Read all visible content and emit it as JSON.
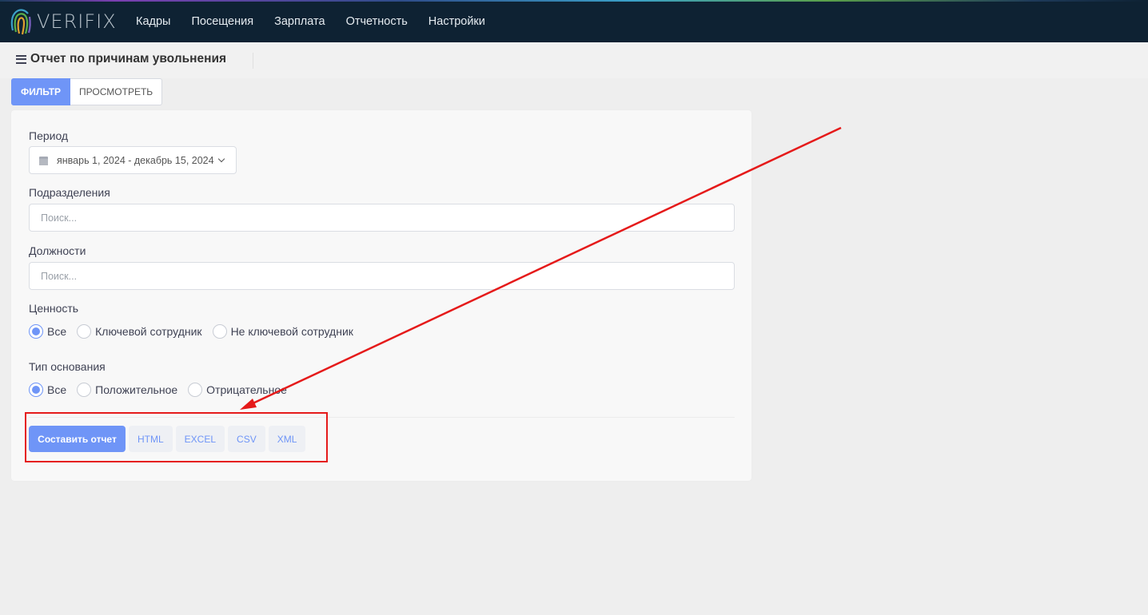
{
  "navbar": {
    "logo_text": "VERIFIX",
    "items": [
      "Кадры",
      "Посещения",
      "Зарплата",
      "Отчетность",
      "Настройки"
    ]
  },
  "page": {
    "title": "Отчет по причинам увольнения"
  },
  "tabs": [
    {
      "label": "ФИЛЬТР",
      "active": true
    },
    {
      "label": "ПРОСМОТРЕТЬ",
      "active": false
    }
  ],
  "form": {
    "period": {
      "label": "Период",
      "value": "январь 1, 2024 - декабрь 15, 2024"
    },
    "divisions": {
      "label": "Подразделения",
      "placeholder": "Поиск..."
    },
    "positions": {
      "label": "Должности",
      "placeholder": "Поиск..."
    },
    "value_group": {
      "label": "Ценность",
      "options": [
        "Все",
        "Ключевой сотрудник",
        "Не ключевой сотрудник"
      ],
      "selected": "Все"
    },
    "basis_type": {
      "label": "Тип основания",
      "options": [
        "Все",
        "Положительное",
        "Отрицательное"
      ],
      "selected": "Все"
    }
  },
  "actions": {
    "generate": "Составить отчет",
    "formats": [
      "HTML",
      "EXCEL",
      "CSV",
      "XML"
    ]
  },
  "colors": {
    "navbar": "#0e2233",
    "accent": "#6f95f7",
    "annotation": "#e51a1a"
  }
}
